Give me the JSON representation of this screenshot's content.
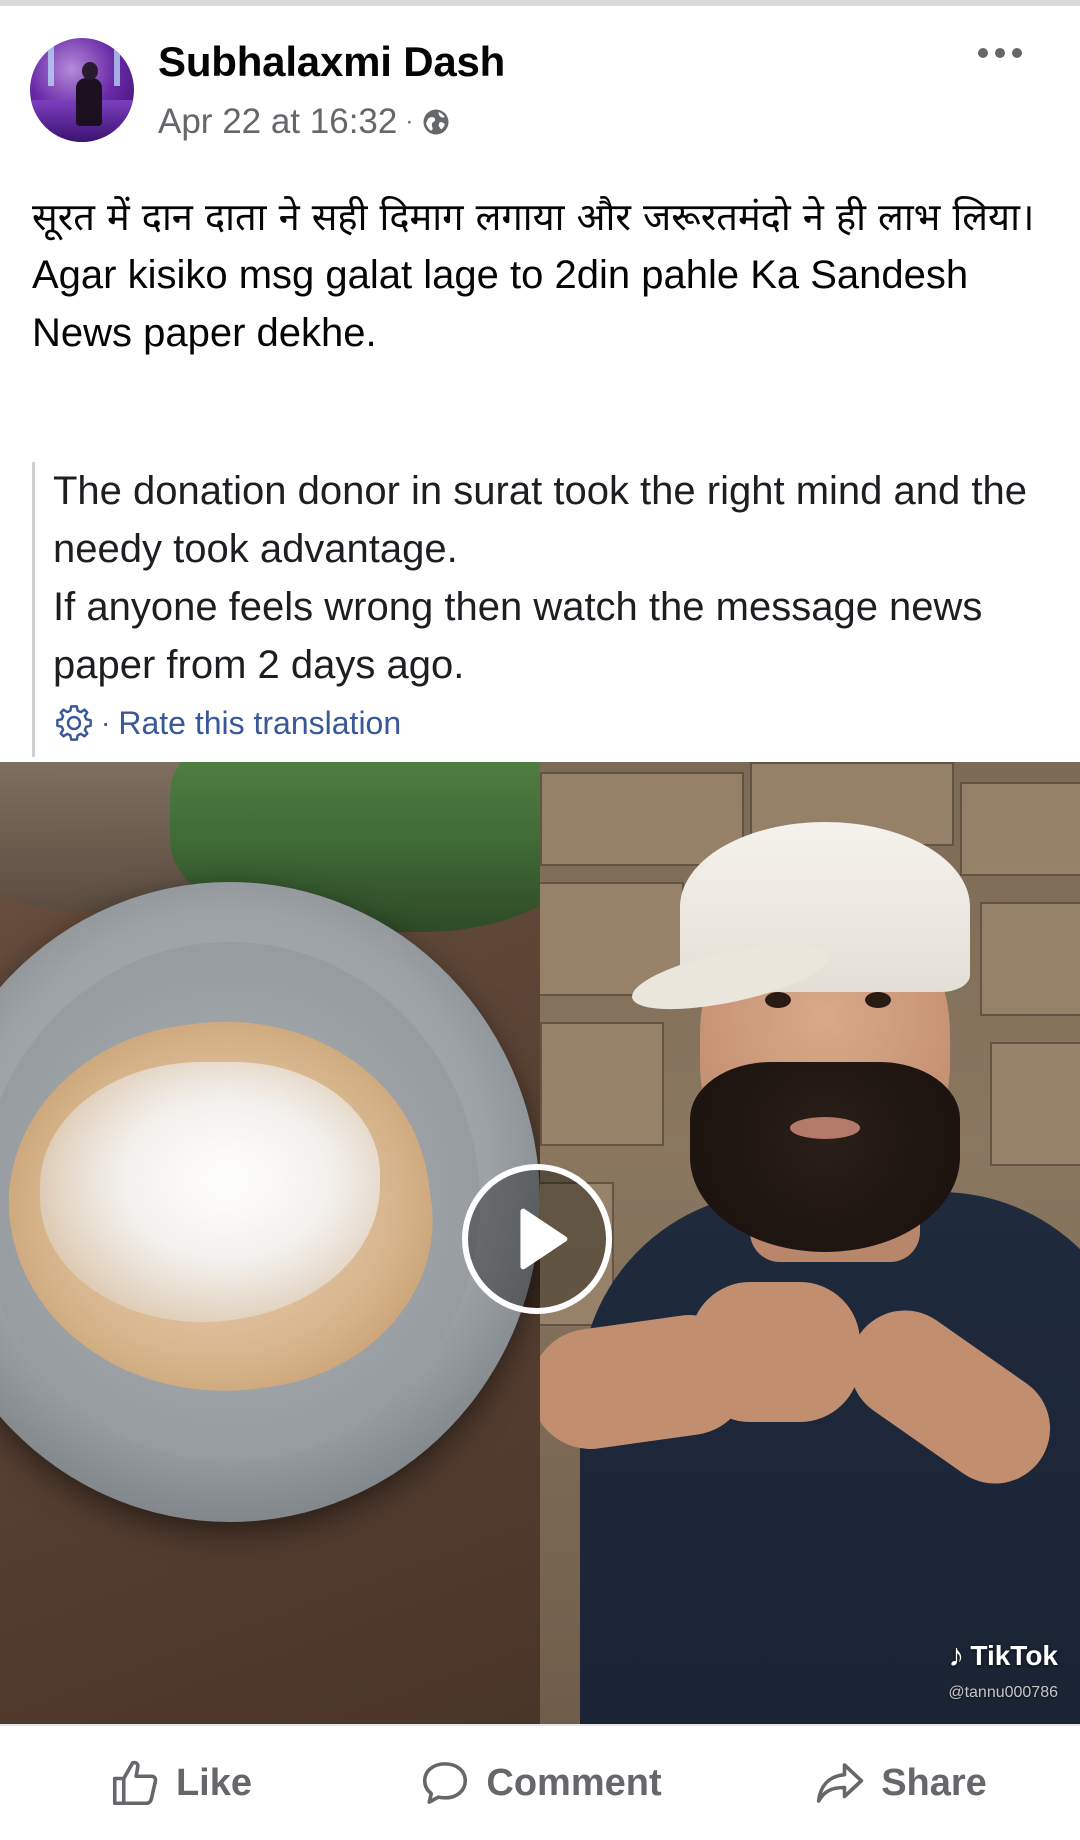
{
  "post": {
    "author": "Subhalaxmi Dash",
    "timestamp": "Apr 22 at 16:32",
    "separator": "·",
    "privacy_icon": "globe-icon",
    "menu_icon": "more-options-icon",
    "text_hindi": "सूरत में दान दाता ने  सही दिमाग लगाया और जरूरतमंदो ने ही लाभ लिया।",
    "text_line_2": "Agar kisiko msg galat lage to 2din pahle Ka Sandesh News paper dekhe."
  },
  "translation": {
    "line_1": "The donation donor in surat took the right mind and the needy took advantage.",
    "line_2": "If anyone feels wrong then watch the message news paper from 2 days ago.",
    "settings_icon": "gear-icon",
    "separator": "·",
    "rate_link": "Rate this translation"
  },
  "video": {
    "play_icon": "play-icon",
    "watermark": "TikTok",
    "handle": "@tannu000786"
  },
  "actions": {
    "like": "Like",
    "comment": "Comment",
    "share": "Share"
  },
  "colors": {
    "text": "#050505",
    "meta": "#65676b",
    "link": "#385898",
    "divider": "#e4e6eb"
  }
}
